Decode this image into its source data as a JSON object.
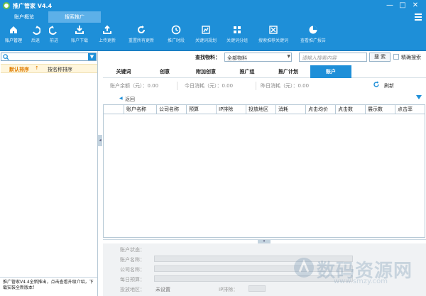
{
  "window": {
    "title": "推广管家 V4.4",
    "controls": [
      "—",
      "□",
      "✕"
    ]
  },
  "top_tabs": [
    {
      "label": "账户概览",
      "active": false
    },
    {
      "label": "搜索推广",
      "active": true
    }
  ],
  "toolbar": [
    {
      "label": "账户管理",
      "icon": "home-icon"
    },
    {
      "label": "后退",
      "icon": "undo-icon"
    },
    {
      "label": "前进",
      "icon": "redo-icon"
    },
    {
      "label": "账户下载",
      "icon": "download-icon"
    },
    {
      "label": "上传更新",
      "icon": "upload-icon"
    },
    {
      "label": "重置所有更新",
      "icon": "reset-icon"
    },
    {
      "label": "推广时段",
      "icon": "clock-icon"
    },
    {
      "label": "关键词规划",
      "icon": "keyword-icon"
    },
    {
      "label": "关键词分组",
      "icon": "group-icon"
    },
    {
      "label": "搜索推荐关键词",
      "icon": "recommend-icon"
    },
    {
      "label": "查看推广报告",
      "icon": "report-icon"
    }
  ],
  "left": {
    "search_placeholder": "",
    "sort_default": "默认排序",
    "sort_default_arrow": "↑",
    "sort_name": "按名称排序",
    "footer_text": "推广管家V4.4全新推出，点击查看升级介绍，下载安装全新版本！"
  },
  "find": {
    "label": "查找物料：",
    "selected": "全部物料",
    "placeholder": "请输入搜索内容",
    "button": "搜 索",
    "exact_label": "精确搜索",
    "exact_checked": false
  },
  "sub_tabs": [
    {
      "label": "关键词",
      "active": false
    },
    {
      "label": "创意",
      "active": false
    },
    {
      "label": "附加创意",
      "active": false
    },
    {
      "label": "推广组",
      "active": false
    },
    {
      "label": "推广计划",
      "active": false
    },
    {
      "label": "账户",
      "active": true
    }
  ],
  "balance": {
    "balance_label": "账户余额（元）：0.00",
    "today_label": "今日消耗（元）：0.00",
    "yesterday_label": "昨日消耗（元）：0.00",
    "refresh": "刷新"
  },
  "back": {
    "label": "返回"
  },
  "table": {
    "columns": [
      "账户名称",
      "公司名称",
      "预算",
      "IP排除",
      "投放地区",
      "消耗",
      "点击均价",
      "点击数",
      "展示数",
      "点击率"
    ]
  },
  "form": {
    "status": "账户状态：",
    "name": "账户名称：",
    "company": "公司名称：",
    "budget": "每日预算：",
    "region": "投放地区：",
    "region_value": "未设置",
    "ip_exclude": "IP排除："
  },
  "watermark": {
    "text": "数码资源网",
    "url": "www.smzy.com"
  },
  "colors": {
    "accent": "#1e8fd8",
    "sort_highlight": "#e07c00"
  }
}
